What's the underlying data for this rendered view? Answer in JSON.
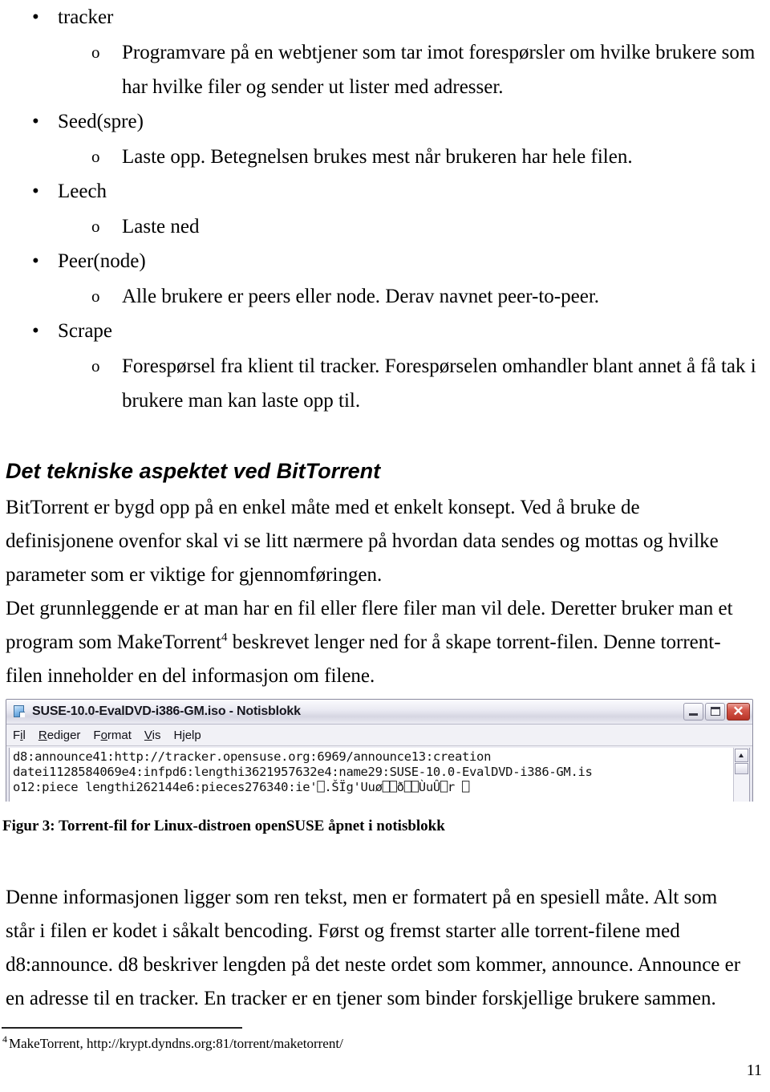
{
  "document": {
    "page_number": "11",
    "glossary": [
      {
        "term": "tracker",
        "bullet": "•",
        "sub_marker": "o",
        "definition": "Programvare på en webtjener som tar imot forespørsler om hvilke brukere som har hvilke filer og sender ut lister med adresser."
      },
      {
        "term": "Seed(spre)",
        "bullet": "•",
        "sub_marker": "o",
        "definition": "Laste opp. Betegnelsen brukes mest når brukeren har hele filen."
      },
      {
        "term": "Leech",
        "bullet": "•",
        "sub_marker": "o",
        "definition": "Laste ned"
      },
      {
        "term": "Peer(node)",
        "bullet": "•",
        "sub_marker": "o",
        "definition": "Alle brukere er peers eller node. Derav navnet peer-to-peer."
      },
      {
        "term": "Scrape",
        "bullet": "•",
        "sub_marker": "o",
        "definition": "Forespørsel fra klient til tracker. Forespørselen omhandler blant annet å få tak i brukere man kan laste opp til."
      }
    ],
    "heading": "Det tekniske aspektet ved BitTorrent",
    "paragraph_1": "BitTorrent er bygd opp på en enkel måte med et enkelt konsept. Ved å bruke de definisjonene ovenfor skal vi se litt nærmere på hvordan data sendes og mottas og hvilke parameter som er viktige for gjennomføringen.",
    "paragraph_2_part1": "Det grunnleggende er at man har en fil eller flere filer man vil dele. Deretter bruker man et program som MakeTorrent",
    "paragraph_2_footnote_ref": "4",
    "paragraph_2_part2": " beskrevet lenger ned for å skape torrent-filen. Denne torrent-filen inneholder en del informasjon om filene.",
    "paragraph_3": "Denne informasjonen ligger som ren tekst, men er formatert på en spesiell måte. Alt som står i filen er kodet i såkalt bencoding. Først og fremst starter alle torrent-filene med d8:announce. d8 beskriver lengden på det neste ordet som kommer, announce. Announce er en adresse til en tracker. En tracker er en tjener som binder forskjellige brukere sammen.",
    "figure_caption": "Figur 3: Torrent-fil for Linux-distroen openSUSE åpnet i notisblokk",
    "footnote": {
      "ref": "4",
      "text": "MakeTorrent, http://krypt.dyndns.org:81/torrent/maketorrent/"
    }
  },
  "notepad": {
    "title": "SUSE-10.0-EvalDVD-i386-GM.iso - Notisblokk",
    "icon": "notepad-document-icon",
    "window_buttons": {
      "minimize": "minimize-icon",
      "maximize": "maximize-icon",
      "close": "✕"
    },
    "menu": [
      {
        "label_pre": "F",
        "label_under": "i",
        "label_post": "l",
        "full": "Fil"
      },
      {
        "label_pre": "",
        "label_under": "R",
        "label_post": "ediger",
        "full": "Rediger"
      },
      {
        "label_pre": "F",
        "label_under": "o",
        "label_post": "rmat",
        "full": "Format"
      },
      {
        "label_pre": "",
        "label_under": "V",
        "label_post": "is",
        "full": "Vis"
      },
      {
        "label_pre": "H",
        "label_under": "j",
        "label_post": "elp",
        "full": "Hjelp"
      }
    ],
    "content_lines": [
      "d8:announce41:http://tracker.opensuse.org:6969/announce13:creation",
      "datei1128584069e4:infpd6:lengthi3621957632e4:name29:SUSE-10.0-EvalDVD-i386-GM.is",
      "o12:piece lengthi262144e6:pieces276340:ie'⎕.ŠÏg'Uuø⎕⎕ð⎕⎕ÙuÛ⎕r ⎕"
    ],
    "scrollbar": {
      "up_arrow": "scroll-up-icon"
    }
  },
  "colors": {
    "text": "#000000",
    "page_bg": "#ffffff",
    "window_chrome": "#e9e9f2",
    "close_button": "#c14437"
  }
}
